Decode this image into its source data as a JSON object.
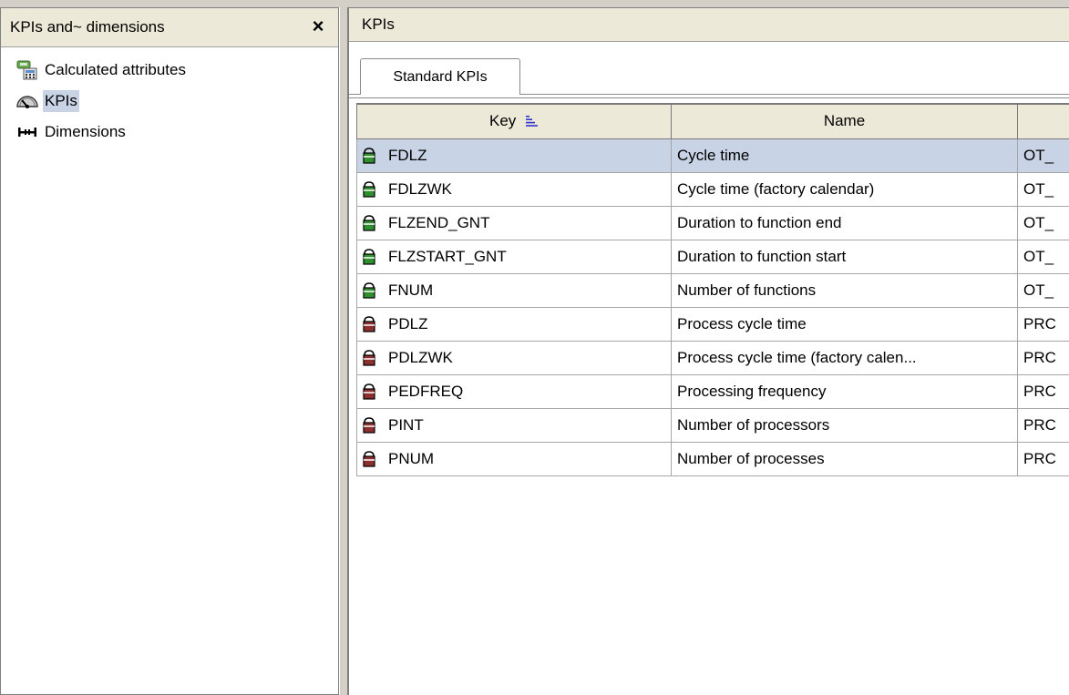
{
  "left_panel": {
    "title": "KPIs and~ dimensions",
    "close_label": "×",
    "tree": [
      {
        "label": "Calculated attributes",
        "icon": "calculator-icon"
      },
      {
        "label": "KPIs",
        "icon": "gauge-icon",
        "selected": true
      },
      {
        "label": "Dimensions",
        "icon": "dimension-icon"
      }
    ]
  },
  "right_panel": {
    "title": "KPIs",
    "tab": "Standard KPIs",
    "columns": {
      "key": "Key",
      "name": "Name",
      "third": ""
    },
    "rows": [
      {
        "key": "FDLZ",
        "name": "Cycle time",
        "third": "OT_",
        "icon_color": "green",
        "selected": true
      },
      {
        "key": "FDLZWK",
        "name": "Cycle time (factory calendar)",
        "third": "OT_",
        "icon_color": "green"
      },
      {
        "key": "FLZEND_GNT",
        "name": "Duration to function end",
        "third": "OT_",
        "icon_color": "green"
      },
      {
        "key": "FLZSTART_GNT",
        "name": "Duration to function start",
        "third": "OT_",
        "icon_color": "green"
      },
      {
        "key": "FNUM",
        "name": "Number of functions",
        "third": "OT_",
        "icon_color": "green"
      },
      {
        "key": "PDLZ",
        "name": "Process cycle time",
        "third": "PRC",
        "icon_color": "brown"
      },
      {
        "key": "PDLZWK",
        "name": "Process cycle time (factory calen...",
        "third": "PRC",
        "icon_color": "brown"
      },
      {
        "key": "PEDFREQ",
        "name": "Processing frequency",
        "third": "PRC",
        "icon_color": "brown"
      },
      {
        "key": "PINT",
        "name": "Number of processors",
        "third": "PRC",
        "icon_color": "brown"
      },
      {
        "key": "PNUM",
        "name": "Number of processes",
        "third": "PRC",
        "icon_color": "brown"
      }
    ]
  },
  "colors": {
    "selection": "#c8d4e6",
    "header_bg": "#ece9d8",
    "green_icon": "#2f8f2f",
    "brown_icon": "#8b2f2f",
    "sort_icon": "#3333cc"
  }
}
